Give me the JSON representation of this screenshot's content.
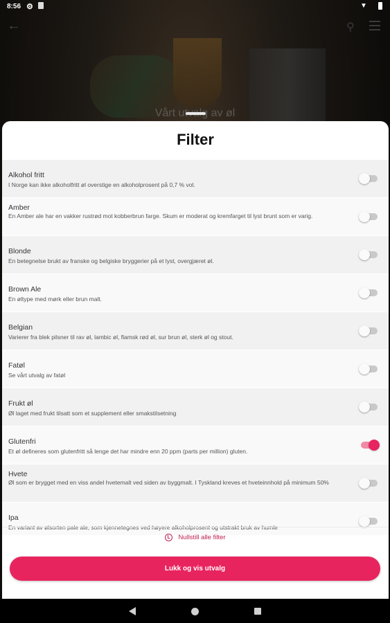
{
  "status_bar": {
    "time": "8:56"
  },
  "background": {
    "title": "Vårt utvalg av øl"
  },
  "sheet": {
    "title": "Filter",
    "filters": [
      {
        "title": "Alkohol fritt",
        "description": "I Norge kan ikke alkoholfritt øl overstige en alkoholprosent på 0,7 % vol.",
        "enabled": false
      },
      {
        "title": "Amber",
        "description": "En Amber ale har en vakker rustrød mot kobberbrun farge. Skum er moderat og kremfarget til lyst brunt som er varig.",
        "enabled": false
      },
      {
        "title": "Blonde",
        "description": "En betegnelse brukt av franske og belgiske bryggerier på et lyst, overgjæret øl.",
        "enabled": false
      },
      {
        "title": "Brown Ale",
        "description": "En øltype med mørk eller brun malt.",
        "enabled": false
      },
      {
        "title": "Belgian",
        "description": "Varierer fra blek pilsner til rav øl, lambic øl, flamsk rød øl, sur brun øl, sterk øl og stout.",
        "enabled": false
      },
      {
        "title": "Fatøl",
        "description": "Se vårt utvalg av fatøl",
        "enabled": false
      },
      {
        "title": "Frukt øl",
        "description": "Øl laget med frukt tilsatt som et supplement eller smakstilsetning",
        "enabled": false
      },
      {
        "title": "Glutenfri",
        "description": "Et øl defineres som glutenfritt så lenge det har mindre enn 20 ppm (parts per million) gluten.",
        "enabled": true
      },
      {
        "title": "Hvete",
        "description": "Øl som er brygget med en viss andel hvetemalt ved siden av byggmalt. I Tyskland kreves et hveteinnhold på minimum 50%",
        "enabled": false
      },
      {
        "title": "Ipa",
        "description": "En variant av ølsorten pale ale, som kjennetegnes ved høyere alkoholprosent og utstrakt bruk av humle",
        "enabled": false
      }
    ],
    "reset_label": "Nullstill alle filter",
    "close_label": "Lukk og vis utvalg"
  },
  "colors": {
    "accent": "#e8245f",
    "toggle_on_track": "#f08aa6"
  }
}
